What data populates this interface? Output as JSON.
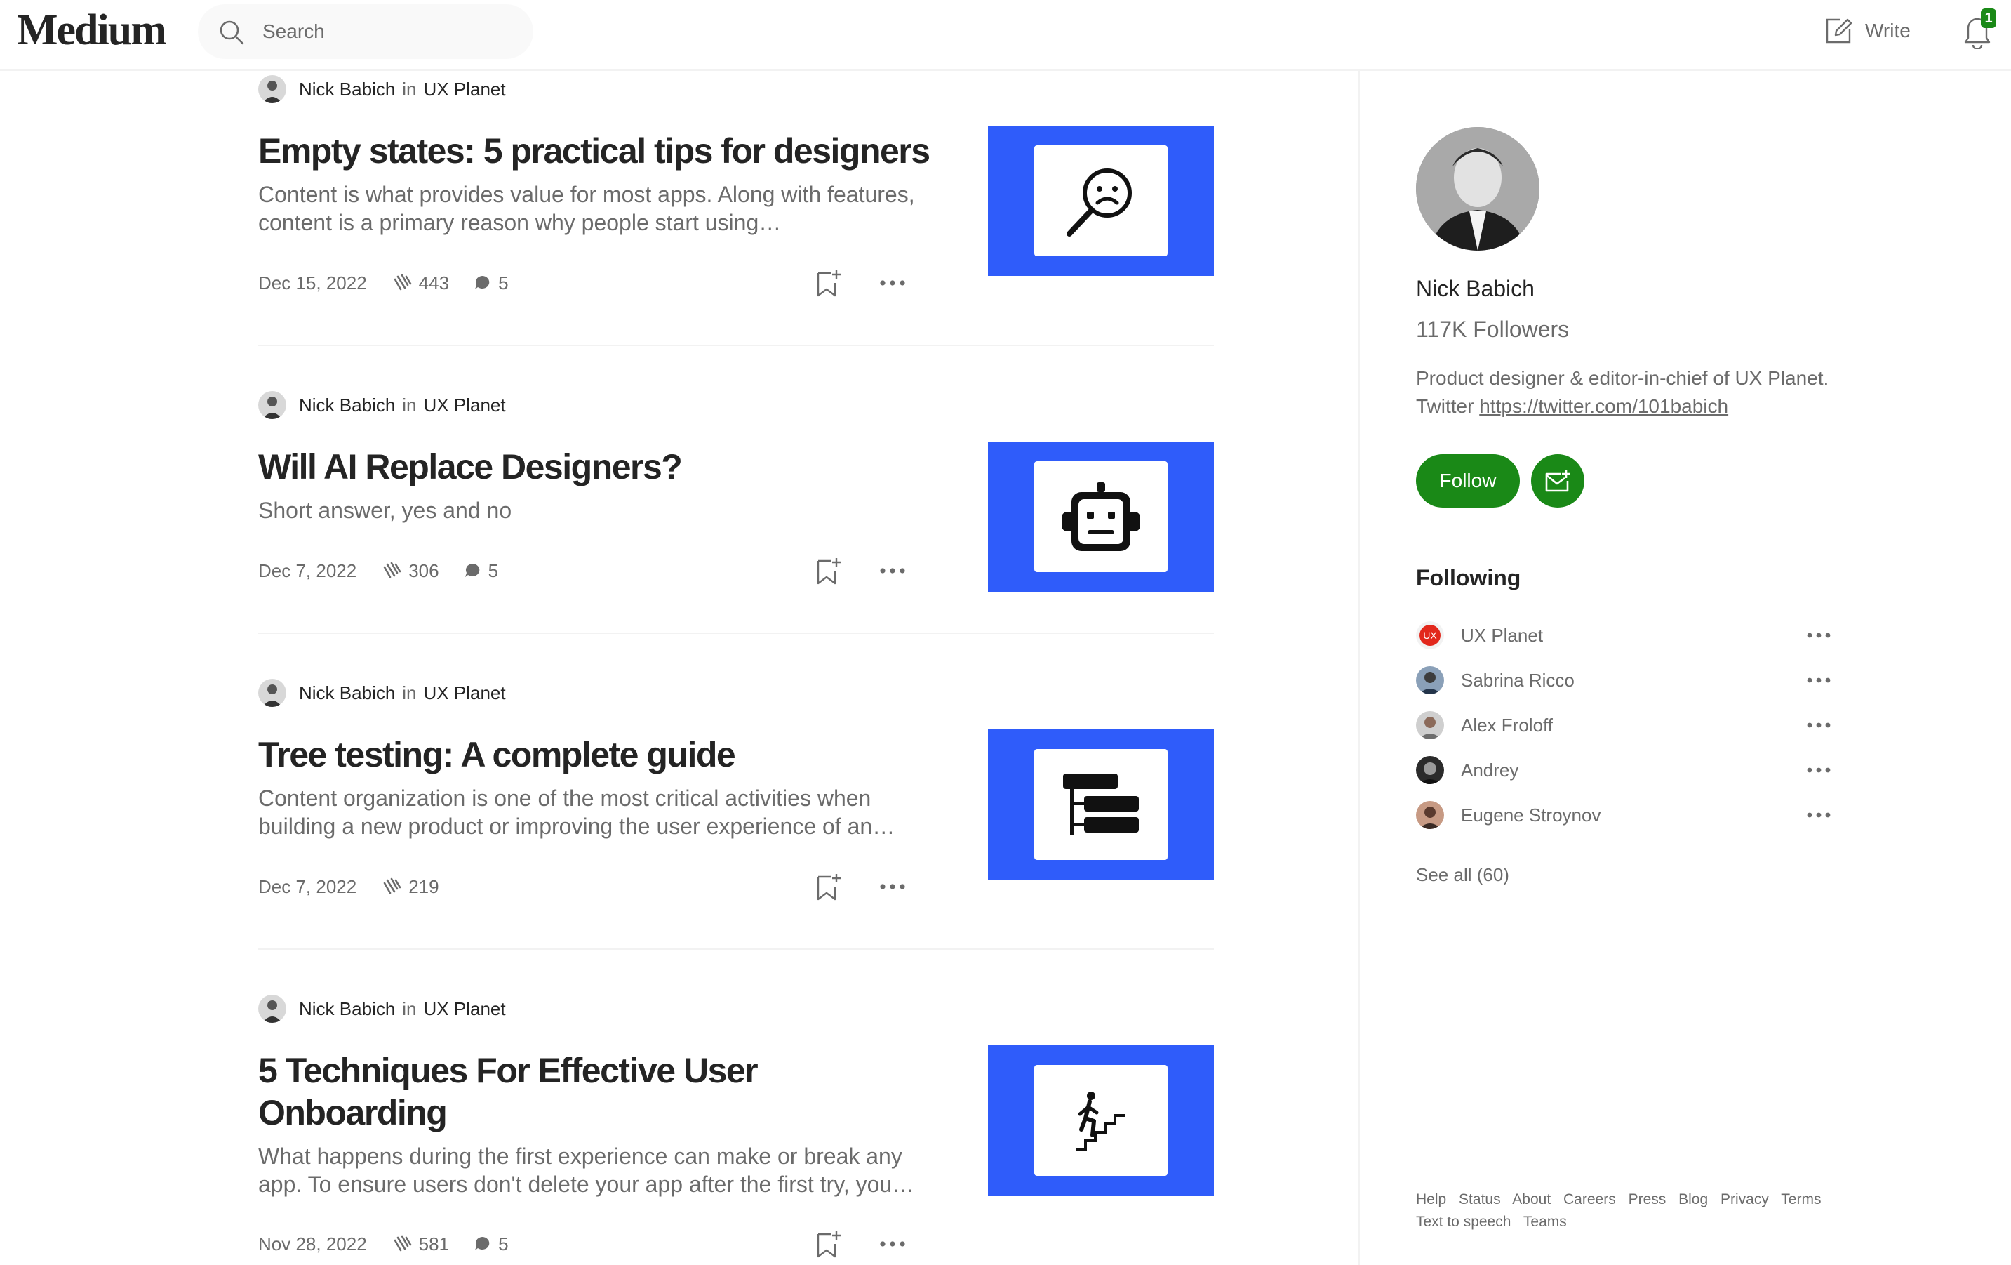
{
  "app": {
    "logo": "Medium"
  },
  "search": {
    "placeholder": "Search"
  },
  "header": {
    "write_label": "Write",
    "notification_count": "1"
  },
  "articles": [
    {
      "author": "Nick Babich",
      "in": "in",
      "publication": "UX Planet",
      "title": "Empty states: 5 practical tips for designers",
      "subtitle": "Content is what provides value for most apps. Along with features, content is a primary reason why people start using…",
      "date": "Dec 15, 2022",
      "claps": "443",
      "responses": "5",
      "thumb_icon": "search-sad-icon"
    },
    {
      "author": "Nick Babich",
      "in": "in",
      "publication": "UX Planet",
      "title": "Will AI Replace Designers?",
      "subtitle": "Short answer, yes and no",
      "date": "Dec 7, 2022",
      "claps": "306",
      "responses": "5",
      "thumb_icon": "robot-icon"
    },
    {
      "author": "Nick Babich",
      "in": "in",
      "publication": "UX Planet",
      "title": "Tree testing: A complete guide",
      "subtitle": "Content organization is one of the most critical activities when building a new product or improving the user experience of an…",
      "date": "Dec 7, 2022",
      "claps": "219",
      "thumb_icon": "tree-structure-icon"
    },
    {
      "author": "Nick Babich",
      "in": "in",
      "publication": "UX Planet",
      "title": "5 Techniques For Effective User Onboarding",
      "subtitle": "What happens during the first experience can make or break any app. To ensure users don't delete your app after the first try, you…",
      "date": "Nov 28, 2022",
      "claps": "581",
      "responses": "5",
      "thumb_icon": "person-climbing-stairs-icon"
    }
  ],
  "profile": {
    "name": "Nick Babich",
    "followers": "117K Followers",
    "bio_text": "Product designer & editor-in-chief of UX Planet. Twitter ",
    "bio_link": "https://twitter.com/101babich",
    "follow_label": "Follow"
  },
  "following": {
    "heading": "Following",
    "items": [
      {
        "name": "UX Planet",
        "avatar_text": "UX"
      },
      {
        "name": "Sabrina Ricco"
      },
      {
        "name": "Alex Froloff"
      },
      {
        "name": "Andrey"
      },
      {
        "name": "Eugene Stroynov"
      }
    ],
    "see_all": "See all (60)"
  },
  "footer": {
    "links": [
      "Help",
      "Status",
      "About",
      "Careers",
      "Press",
      "Blog",
      "Privacy",
      "Terms",
      "Text to speech",
      "Teams"
    ]
  },
  "colors": {
    "accent_green": "#1a8917",
    "thumb_blue": "#2f5cfa",
    "text_primary": "#242424",
    "text_secondary": "#6b6b6b"
  }
}
